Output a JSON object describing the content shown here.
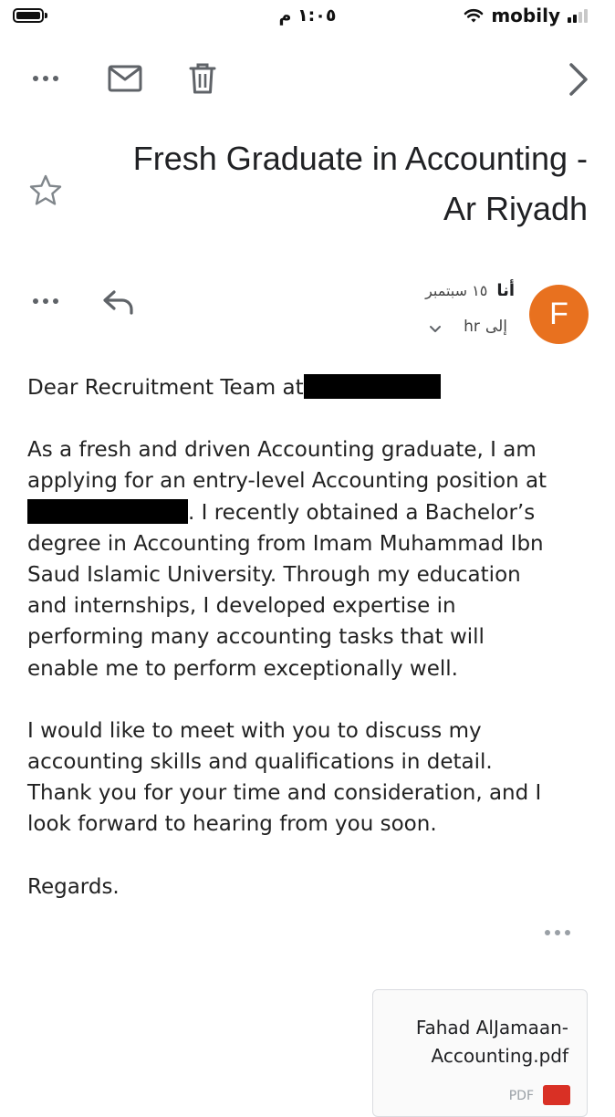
{
  "status_bar": {
    "time": "١:٠٥ م",
    "carrier": "mobily",
    "signal_bars": 4,
    "signal_active": 2
  },
  "toolbar": {
    "icons": [
      "more-icon",
      "mail-icon",
      "trash-icon",
      "next-icon"
    ]
  },
  "email": {
    "subject_line1": "Fresh Graduate in Accounting -",
    "subject_line2": "Ar Riyadh",
    "sender_initial": "F",
    "sender_name": "أنا",
    "date": "١٥ سبتمبر",
    "to_label": "إلى",
    "recipient": "hr",
    "body": {
      "p1_prefix": "Dear Recruitment Team at",
      "p2_line1": "As a fresh and driven Accounting graduate, I am",
      "p2_line2": "applying for an entry-level Accounting position at",
      "p2_line3_suffix": ". I recently obtained a Bachelor’s",
      "p2_line4": "degree in Accounting from Imam Muhammad Ibn",
      "p2_line5": "Saud Islamic University. Through my education",
      "p2_line6": "and internships, I developed expertise in",
      "p2_line7": "performing many accounting tasks that will",
      "p2_line8": "enable me to perform exceptionally well.",
      "p3_line1": "I would like to meet with you to discuss my",
      "p3_line2": "accounting skills and qualifications in detail.",
      "p3_line3": "Thank you for your time and consideration, and I",
      "p3_line4": "look forward to hearing from you soon.",
      "closing": "Regards."
    },
    "attachment": {
      "name_line1": "Fahad AlJamaan-",
      "name_line2": "Accounting.pdf",
      "type": "PDF"
    }
  },
  "colors": {
    "avatar": "#e8711f",
    "icon_gray": "#5f6368",
    "pdf_red": "#d93025"
  }
}
